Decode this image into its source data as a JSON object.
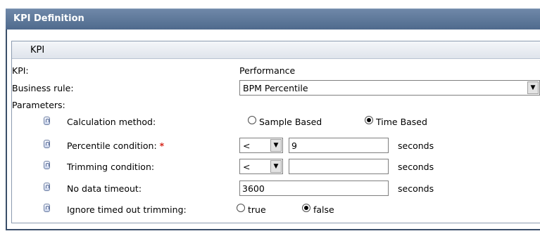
{
  "panel": {
    "title": "KPI Definition"
  },
  "section": {
    "title": "KPI"
  },
  "kpi": {
    "label": "KPI:",
    "value": "Performance"
  },
  "business_rule": {
    "label": "Business rule:",
    "selected": "BPM Percentile"
  },
  "parameters": {
    "label": "Parameters:",
    "calculation_method": {
      "label": "Calculation method:",
      "options": [
        "Sample Based",
        "Time Based"
      ],
      "selected": "Time Based"
    },
    "percentile_condition": {
      "label": "Percentile condition:",
      "required_mark": "*",
      "operator": "<",
      "value": "9",
      "units": "seconds"
    },
    "trimming_condition": {
      "label": "Trimming condition:",
      "operator": "<",
      "value": "",
      "units": "seconds"
    },
    "no_data_timeout": {
      "label": "No data timeout:",
      "value": "3600",
      "units": "seconds"
    },
    "ignore_timed_out_trimming": {
      "label": "Ignore timed out trimming:",
      "options": [
        "true",
        "false"
      ],
      "selected": "false"
    }
  },
  "icons": {
    "parameter_info": "parameter-info-icon",
    "dropdown": "chevron-down-icon"
  }
}
